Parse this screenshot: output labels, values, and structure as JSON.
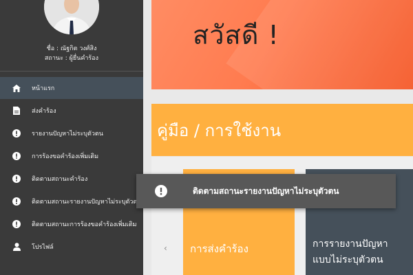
{
  "profile": {
    "name": "ชื่อ : ณัฐกิต วงศ์สิง",
    "status": "สถานะ : ผู้ยื่นคำร้อง"
  },
  "nav": {
    "items": [
      {
        "label": "หน้าแรก",
        "icon": "home-icon"
      },
      {
        "label": "ส่งคำร้อง",
        "icon": "document-icon"
      },
      {
        "label": "รายงานปัญหาไม่ระบุตัวตน",
        "icon": "alert-icon"
      },
      {
        "label": "การร้องขอคำร้องเพิ่มเติม",
        "icon": "alert-icon"
      },
      {
        "label": "ติดตามสถานะคำร้อง",
        "icon": "alert-icon"
      },
      {
        "label": "ติดตามสถานะรายงานปัญหาไม่ระบุตัวตน",
        "icon": "alert-icon"
      },
      {
        "label": "ติดตามสถานะการร้องขอคำร้องเพิ่มเติม",
        "icon": "alert-icon"
      },
      {
        "label": "โปรไฟล์",
        "icon": "person-icon"
      }
    ]
  },
  "hero": {
    "title": "สวัสดี !"
  },
  "section": {
    "title": "คู่มือ / การใช้งาน"
  },
  "cards": {
    "orange_label": "การส่งคำร้อง",
    "dark_label_1": "การรายงานปัญหา",
    "dark_label_2": "แบบไม่ระบุตัวตน",
    "chevron": "‹"
  },
  "tooltip": {
    "text": "ติดตามสถานะรายงานปัญหาไม่ระบุตัวตน"
  },
  "colors": {
    "sidebar": "#3a3a3a",
    "accent_orange": "#ffb040",
    "hero_orange": "#ff7b4f",
    "card_dark": "#45505a"
  }
}
